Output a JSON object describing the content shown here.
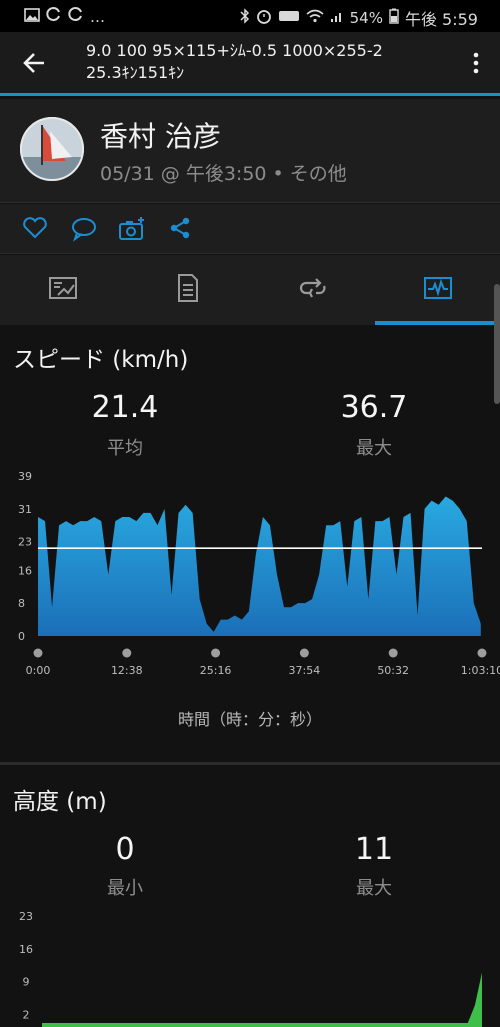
{
  "status_bar": {
    "left_icons": [
      "image-icon",
      "sync-icon",
      "sync-icon",
      "more-dots"
    ],
    "battery": "54%",
    "time": "午後 5:59"
  },
  "app_bar": {
    "title_line1": "9.0 100 95×115+ｼﾑ-0.5 1000×255-2",
    "title_line2": "25.3ｷﾝ151ｷﾝ"
  },
  "header": {
    "athlete_name": "香村 治彦",
    "meta": "05/31 @ 午後3:50 • その他"
  },
  "speed": {
    "title": "スピード (km/h)",
    "avg_value": "21.4",
    "avg_label": "平均",
    "max_value": "36.7",
    "max_label": "最大",
    "x_axis_title": "時間（時：分：秒）"
  },
  "altitude": {
    "title": "高度 (m)",
    "min_value": "0",
    "min_label": "最小",
    "max_value": "11",
    "max_label": "最大"
  },
  "colors": {
    "accent": "#1b8ed1",
    "speed_fill_top": "#29a9e0",
    "speed_fill_bottom": "#1b6fb8",
    "altitude_fill": "#3fbf4a",
    "avg_line": "#ffffff"
  },
  "chart_data": [
    {
      "type": "area",
      "title": "スピード (km/h)",
      "xlabel": "時間（時：分：秒）",
      "ylabel": "",
      "y_ticks": [
        "39",
        "31",
        "23",
        "16",
        "8",
        "0"
      ],
      "x_tick_labels": [
        "0:00",
        "12:38",
        "25:16",
        "37:54",
        "50:32",
        "1:03:10"
      ],
      "ylim": [
        0,
        39
      ],
      "average": 21.4,
      "x_minutes": [
        0,
        1,
        2,
        3,
        4,
        5,
        6,
        7,
        8,
        9,
        10,
        11,
        12,
        13,
        14,
        15,
        16,
        17,
        18,
        19,
        20,
        21,
        22,
        23,
        24,
        25,
        26,
        27,
        28,
        29,
        30,
        31,
        32,
        33,
        34,
        35,
        36,
        37,
        38,
        39,
        40,
        41,
        42,
        43,
        44,
        45,
        46,
        47,
        48,
        49,
        50,
        51,
        52,
        53,
        54,
        55,
        56,
        57,
        58,
        59,
        60,
        61,
        62,
        63
      ],
      "values": [
        29,
        28,
        7,
        27,
        28,
        27,
        28,
        28,
        29,
        28,
        15,
        28,
        29,
        29,
        28,
        30,
        30,
        27,
        31,
        10,
        30,
        32,
        30,
        9,
        3,
        1,
        4,
        4,
        5,
        4,
        6,
        20,
        29,
        27,
        15,
        7,
        7,
        8,
        8,
        9,
        15,
        27,
        27,
        28,
        12,
        28,
        29,
        9,
        28,
        28,
        29,
        15,
        29,
        30,
        5,
        31,
        33,
        32,
        34,
        33,
        31,
        28,
        8,
        3
      ],
      "series": [
        {
          "values": []
        }
      ]
    },
    {
      "type": "area",
      "title": "高度 (m)",
      "y_ticks": [
        "23",
        "16",
        "9",
        "2"
      ],
      "ylim": [
        0,
        23
      ],
      "note_range": "0–11",
      "series": [
        {
          "values": [
            0,
            0,
            0,
            0,
            0,
            0,
            0,
            0,
            0,
            0,
            0,
            0,
            0,
            0,
            0,
            0,
            0,
            0,
            0,
            0,
            0,
            0,
            0,
            0,
            0,
            0,
            0,
            0,
            0,
            0,
            0,
            0,
            0,
            0,
            0,
            0,
            0,
            0,
            0,
            0,
            0,
            0,
            0,
            0,
            0,
            0,
            0,
            0,
            0,
            0,
            0,
            0,
            0,
            0,
            0,
            0,
            0,
            0,
            0,
            0,
            0,
            4,
            11
          ]
        }
      ]
    }
  ]
}
